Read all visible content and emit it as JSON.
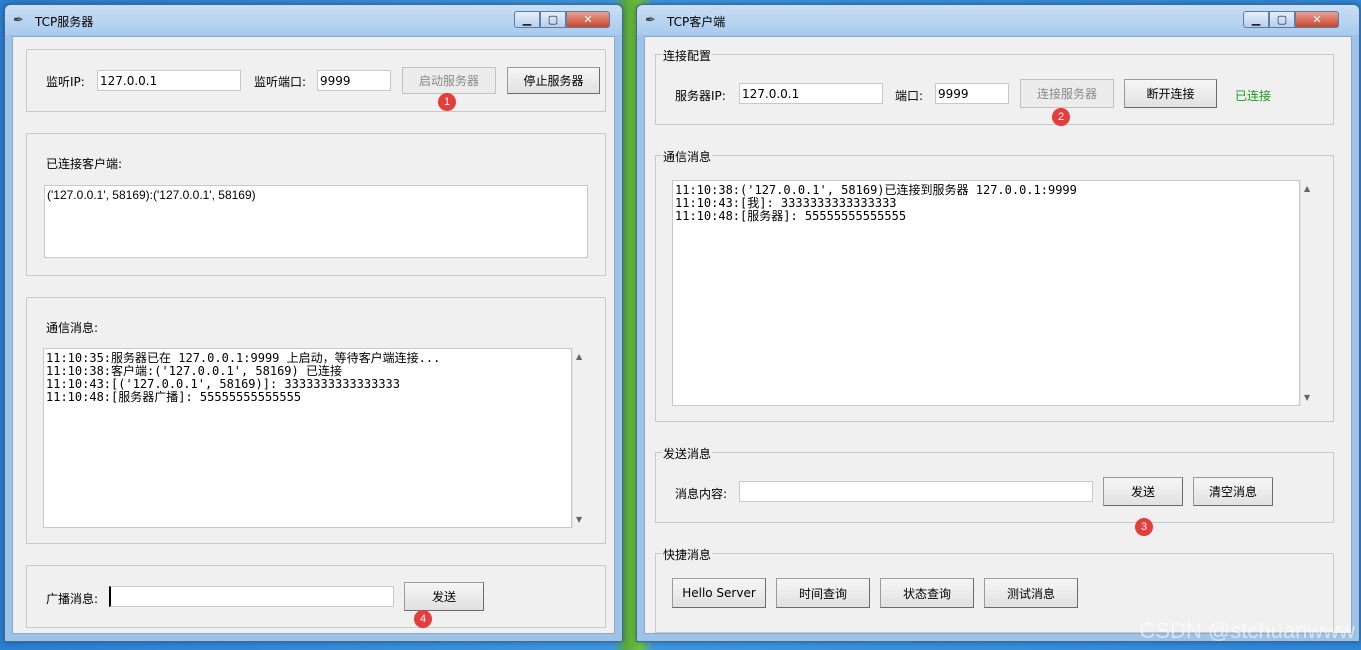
{
  "server": {
    "title": "TCP服务器",
    "listen_ip_label": "监听IP:",
    "listen_ip_value": "127.0.0.1",
    "listen_port_label": "监听端口:",
    "listen_port_value": "9999",
    "start_label": "启动服务器",
    "stop_label": "停止服务器",
    "clients_label": "已连接客户端:",
    "clients": [
      "('127.0.0.1', 58169):('127.0.0.1', 58169)"
    ],
    "messages_label": "通信消息:",
    "messages": [
      "11:10:35:服务器已在 127.0.0.1:9999 上启动，等待客户端连接...",
      "11:10:38:客户端:('127.0.0.1', 58169) 已连接",
      "11:10:43:[('127.0.0.1', 58169)]: 3333333333333333",
      "11:10:48:[服务器广播]: 55555555555555"
    ],
    "broadcast_label": "广播消息:",
    "broadcast_value": "",
    "send_label": "发送"
  },
  "client": {
    "title": "TCP客户端",
    "config_legend": "连接配置",
    "server_ip_label": "服务器IP:",
    "server_ip_value": "127.0.0.1",
    "port_label": "端口:",
    "port_value": "9999",
    "connect_label": "连接服务器",
    "disconnect_label": "断开连接",
    "status_text": "已连接",
    "messages_legend": "通信消息",
    "messages": [
      "11:10:38:('127.0.0.1', 58169)已连接到服务器 127.0.0.1:9999",
      "11:10:43:[我]: 3333333333333333",
      "11:10:48:[服务器]: 55555555555555"
    ],
    "send_legend": "发送消息",
    "content_label": "消息内容:",
    "content_value": "",
    "send_label": "发送",
    "clear_label": "清空消息",
    "quick_legend": "快捷消息",
    "quick": [
      "Hello Server",
      "时间查询",
      "状态查询",
      "测试消息"
    ]
  },
  "badges": [
    "1",
    "2",
    "3",
    "4"
  ],
  "watermark": "CSDN @stchuanwww",
  "colors": {
    "status_connected": "#1a9a1a",
    "badge": "#e53c3c"
  }
}
